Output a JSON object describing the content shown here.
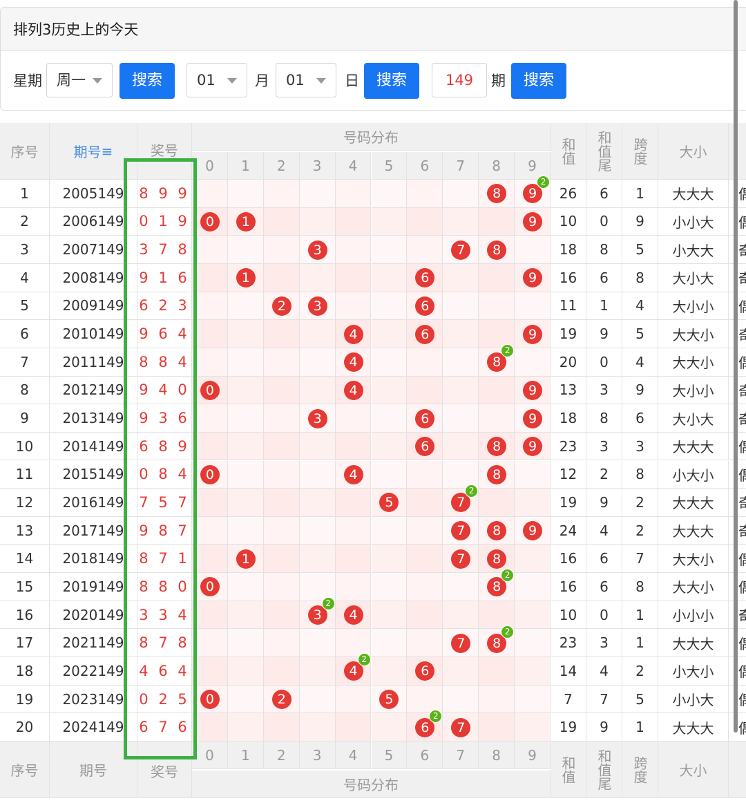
{
  "panel": {
    "title": "排列3历史上的今天",
    "weekday_label": "星期",
    "weekday_value": "周一",
    "search_label": "搜索",
    "month_value": "01",
    "month_label": "月",
    "day_value": "01",
    "day_label": "日",
    "issue_value": "149",
    "issue_label": "期"
  },
  "table": {
    "headers": {
      "seq": "序号",
      "issue": "期号",
      "sort_icon": "≡",
      "prize": "奖号",
      "dist": "号码分布",
      "sum": "和值",
      "sum_tail": "和值尾",
      "span": "跨度",
      "size": "大小"
    },
    "digits": [
      "0",
      "1",
      "2",
      "3",
      "4",
      "5",
      "6",
      "7",
      "8",
      "9"
    ],
    "rows": [
      {
        "seq": "1",
        "issue": "2005149",
        "prize": "8 9 9",
        "sum": "26",
        "tail": "6",
        "span": "1",
        "size": "大大大",
        "extra": "偶",
        "balls": [
          8,
          9
        ],
        "badge": {
          "d": 9,
          "n": "2"
        }
      },
      {
        "seq": "2",
        "issue": "2006149",
        "prize": "0 1 9",
        "sum": "10",
        "tail": "0",
        "span": "9",
        "size": "小小大",
        "extra": "偶",
        "balls": [
          0,
          1,
          9
        ]
      },
      {
        "seq": "3",
        "issue": "2007149",
        "prize": "3 7 8",
        "sum": "18",
        "tail": "8",
        "span": "5",
        "size": "小大大",
        "extra": "奇",
        "balls": [
          3,
          7,
          8
        ]
      },
      {
        "seq": "4",
        "issue": "2008149",
        "prize": "9 1 6",
        "sum": "16",
        "tail": "6",
        "span": "8",
        "size": "大小大",
        "extra": "奇",
        "balls": [
          1,
          6,
          9
        ]
      },
      {
        "seq": "5",
        "issue": "2009149",
        "prize": "6 2 3",
        "sum": "11",
        "tail": "1",
        "span": "4",
        "size": "大小小",
        "extra": "偶",
        "balls": [
          2,
          3,
          6
        ]
      },
      {
        "seq": "6",
        "issue": "2010149",
        "prize": "9 6 4",
        "sum": "19",
        "tail": "9",
        "span": "5",
        "size": "大大小",
        "extra": "奇",
        "balls": [
          4,
          6,
          9
        ]
      },
      {
        "seq": "7",
        "issue": "2011149",
        "prize": "8 8 4",
        "sum": "20",
        "tail": "0",
        "span": "4",
        "size": "大大小",
        "extra": "偶",
        "balls": [
          4,
          8
        ],
        "badge": {
          "d": 8,
          "n": "2"
        }
      },
      {
        "seq": "8",
        "issue": "2012149",
        "prize": "9 4 0",
        "sum": "13",
        "tail": "3",
        "span": "9",
        "size": "大小小",
        "extra": "奇",
        "balls": [
          0,
          4,
          9
        ]
      },
      {
        "seq": "9",
        "issue": "2013149",
        "prize": "9 3 6",
        "sum": "18",
        "tail": "8",
        "span": "6",
        "size": "大小大",
        "extra": "奇",
        "balls": [
          3,
          6,
          9
        ]
      },
      {
        "seq": "10",
        "issue": "2014149",
        "prize": "6 8 9",
        "sum": "23",
        "tail": "3",
        "span": "3",
        "size": "大大大",
        "extra": "偶",
        "balls": [
          6,
          8,
          9
        ]
      },
      {
        "seq": "11",
        "issue": "2015149",
        "prize": "0 8 4",
        "sum": "12",
        "tail": "2",
        "span": "8",
        "size": "小大小",
        "extra": "偶",
        "balls": [
          0,
          4,
          8
        ]
      },
      {
        "seq": "12",
        "issue": "2016149",
        "prize": "7 5 7",
        "sum": "19",
        "tail": "9",
        "span": "2",
        "size": "大大大",
        "extra": "奇",
        "balls": [
          5,
          7
        ],
        "badge": {
          "d": 7,
          "n": "2"
        }
      },
      {
        "seq": "13",
        "issue": "2017149",
        "prize": "9 8 7",
        "sum": "24",
        "tail": "4",
        "span": "2",
        "size": "大大大",
        "extra": "奇",
        "balls": [
          7,
          8,
          9
        ]
      },
      {
        "seq": "14",
        "issue": "2018149",
        "prize": "8 7 1",
        "sum": "16",
        "tail": "6",
        "span": "7",
        "size": "大大小",
        "extra": "偶",
        "balls": [
          1,
          7,
          8
        ]
      },
      {
        "seq": "15",
        "issue": "2019149",
        "prize": "8 8 0",
        "sum": "16",
        "tail": "6",
        "span": "8",
        "size": "大大小",
        "extra": "偶",
        "balls": [
          0,
          8
        ],
        "badge": {
          "d": 8,
          "n": "2"
        }
      },
      {
        "seq": "16",
        "issue": "2020149",
        "prize": "3 3 4",
        "sum": "10",
        "tail": "0",
        "span": "1",
        "size": "小小小",
        "extra": "奇",
        "balls": [
          3,
          4
        ],
        "badge": {
          "d": 3,
          "n": "2"
        }
      },
      {
        "seq": "17",
        "issue": "2021149",
        "prize": "8 7 8",
        "sum": "23",
        "tail": "3",
        "span": "1",
        "size": "大大大",
        "extra": "偶",
        "balls": [
          7,
          8
        ],
        "badge": {
          "d": 8,
          "n": "2"
        }
      },
      {
        "seq": "18",
        "issue": "2022149",
        "prize": "4 6 4",
        "sum": "14",
        "tail": "4",
        "span": "2",
        "size": "小大小",
        "extra": "偶",
        "balls": [
          4,
          6
        ],
        "badge": {
          "d": 4,
          "n": "2"
        }
      },
      {
        "seq": "19",
        "issue": "2023149",
        "prize": "0 2 5",
        "sum": "7",
        "tail": "7",
        "span": "5",
        "size": "小小大",
        "extra": "偶",
        "balls": [
          0,
          2,
          5
        ]
      },
      {
        "seq": "20",
        "issue": "2024149",
        "prize": "6 7 6",
        "sum": "19",
        "tail": "9",
        "span": "1",
        "size": "大大大",
        "extra": "偶",
        "balls": [
          6,
          7
        ],
        "badge": {
          "d": 6,
          "n": "2"
        }
      }
    ]
  },
  "colors": {
    "accent": "#1976f2",
    "ball": "#e53935",
    "badge": "#5ab31a",
    "highlight_box": "#3cb043"
  }
}
